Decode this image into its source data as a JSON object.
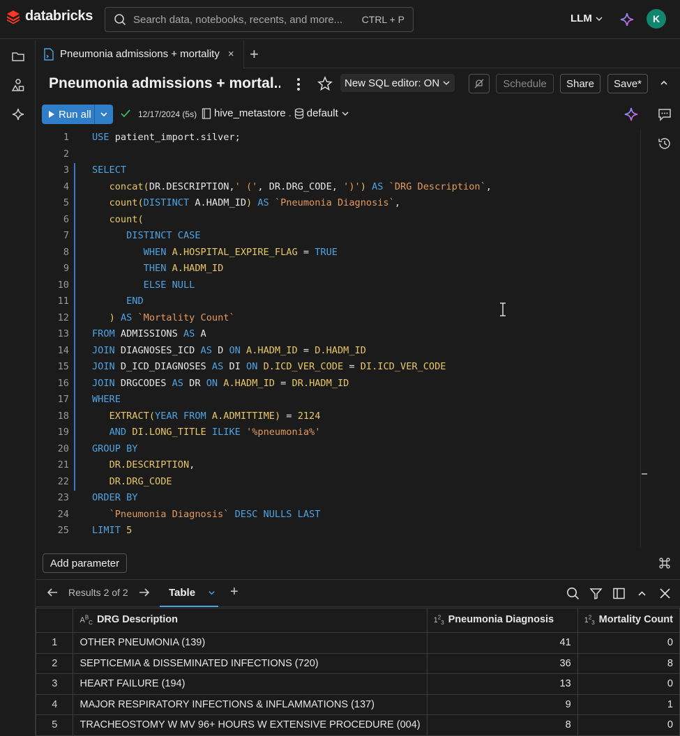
{
  "brand": {
    "name": "databricks"
  },
  "search": {
    "placeholder": "Search data, notebooks, recents, and more...",
    "shortcut": "CTRL + P"
  },
  "header": {
    "llm_label": "LLM",
    "avatar_initial": "K"
  },
  "tab": {
    "label": "Pneumonia admissions + mortality",
    "close": "×",
    "add": "+"
  },
  "toolbar": {
    "title": "Pneumonia admissions + mortal...",
    "sql_editor_toggle": "New SQL editor: ON",
    "schedule": "Schedule",
    "share": "Share",
    "save": "Save*"
  },
  "run": {
    "run_all": "Run all",
    "status": "12/17/2024 (5s)",
    "catalog": "hive_metastore",
    "schema": "default"
  },
  "code_lines": [
    {
      "n": "1",
      "html": "<span class=\"k\">USE</span> patient_import.silver;"
    },
    {
      "n": "2",
      "html": ""
    },
    {
      "n": "3",
      "html": "<span class=\"k\">SELECT</span>"
    },
    {
      "n": "4",
      "html": "   <span class=\"f\">concat</span><span class=\"p\">(</span>DR.DESCRIPTION,<span class=\"s\">' ('</span>, DR.DRG_CODE, <span class=\"s\">')'</span><span class=\"p\">)</span> <span class=\"k\">AS</span> <span class=\"s\">`DRG Description`</span>,"
    },
    {
      "n": "5",
      "html": "   <span class=\"f\">count</span><span class=\"p\">(</span><span class=\"k\">DISTINCT</span> A.HADM_ID<span class=\"p\">)</span> <span class=\"k\">AS</span> <span class=\"s\">`Pneumonia Diagnosis`</span>,"
    },
    {
      "n": "6",
      "html": "   <span class=\"f\">count</span><span class=\"p\">(</span>"
    },
    {
      "n": "7",
      "html": "      <span class=\"k\">DISTINCT CASE</span>"
    },
    {
      "n": "8",
      "html": "         <span class=\"k\">WHEN</span> <span class=\"f\">A.HOSPITAL_EXPIRE_FLAG</span> = <span class=\"k\">TRUE</span>"
    },
    {
      "n": "9",
      "html": "         <span class=\"k\">THEN</span> <span class=\"f\">A.HADM_ID</span>"
    },
    {
      "n": "10",
      "html": "         <span class=\"k\">ELSE NULL</span>"
    },
    {
      "n": "11",
      "html": "      <span class=\"k\">END</span>"
    },
    {
      "n": "12",
      "html": "   <span class=\"p\">)</span> <span class=\"k\">AS</span> <span class=\"s\">`Mortality Count`</span>"
    },
    {
      "n": "13",
      "html": "<span class=\"k\">FROM</span> ADMISSIONS <span class=\"k\">AS</span> A"
    },
    {
      "n": "14",
      "html": "<span class=\"k\">JOIN</span> DIAGNOSES_ICD <span class=\"k\">AS</span> D <span class=\"k\">ON</span> <span class=\"f\">A.HADM_ID</span> = <span class=\"f\">D.HADM_ID</span>"
    },
    {
      "n": "15",
      "html": "<span class=\"k\">JOIN</span> D_ICD_DIAGNOSES <span class=\"k\">AS</span> DI <span class=\"k\">ON</span> <span class=\"f\">D.ICD_VER_CODE</span> = <span class=\"f\">DI.ICD_VER_CODE</span>"
    },
    {
      "n": "16",
      "html": "<span class=\"k\">JOIN</span> DRGCODES <span class=\"k\">AS</span> DR <span class=\"k\">ON</span> <span class=\"f\">A.HADM_ID</span> = <span class=\"f\">DR.HADM_ID</span>"
    },
    {
      "n": "17",
      "html": "<span class=\"k\">WHERE</span>"
    },
    {
      "n": "18",
      "html": "   <span class=\"f\">EXTRACT</span><span class=\"p\">(</span><span class=\"k\">YEAR FROM</span> <span class=\"f\">A.ADMITTIME</span><span class=\"p\">)</span> = <span class=\"f\">2124</span>"
    },
    {
      "n": "19",
      "html": "   <span class=\"k\">AND</span> <span class=\"f\">DI.LONG_TITLE</span> <span class=\"k\">ILIKE</span> <span class=\"s\">'%pneumonia%'</span>"
    },
    {
      "n": "20",
      "html": "<span class=\"k\">GROUP BY</span>"
    },
    {
      "n": "21",
      "html": "   <span class=\"f\">DR.DESCRIPTION</span>,"
    },
    {
      "n": "22",
      "html": "   <span class=\"f\">DR.DRG_CODE</span>"
    },
    {
      "n": "23",
      "html": "<span class=\"k\">ORDER BY</span>"
    },
    {
      "n": "24",
      "html": "   <span class=\"s\">`Pneumonia Diagnosis`</span> <span class=\"k\">DESC NULLS LAST</span>"
    },
    {
      "n": "25",
      "html": "<span class=\"k\">LIMIT</span> <span class=\"f\">5</span>"
    }
  ],
  "add_parameter": "Add parameter",
  "results": {
    "nav_label": "Results 2 of 2",
    "tab_label": "Table",
    "add": "+",
    "columns": [
      "DRG Description",
      "Pneumonia Diagnosis",
      "Mortality Count"
    ],
    "rows": [
      [
        "1",
        "OTHER PNEUMONIA (139)",
        "41",
        "0"
      ],
      [
        "2",
        "SEPTICEMIA & DISSEMINATED INFECTIONS (720)",
        "36",
        "8"
      ],
      [
        "3",
        "HEART FAILURE (194)",
        "13",
        "0"
      ],
      [
        "4",
        "MAJOR RESPIRATORY INFECTIONS & INFLAMMATIONS (137)",
        "9",
        "1"
      ],
      [
        "5",
        "TRACHEOSTOMY W MV 96+ HOURS W EXTENSIVE PROCEDURE (004)",
        "8",
        "0"
      ]
    ]
  },
  "colors": {
    "accent": "#2f7ec7",
    "keyword": "#4fa3e3",
    "identifier": "#e7c766",
    "string": "#e59a5c",
    "success": "#3fb950",
    "avatar": "#11866f"
  }
}
